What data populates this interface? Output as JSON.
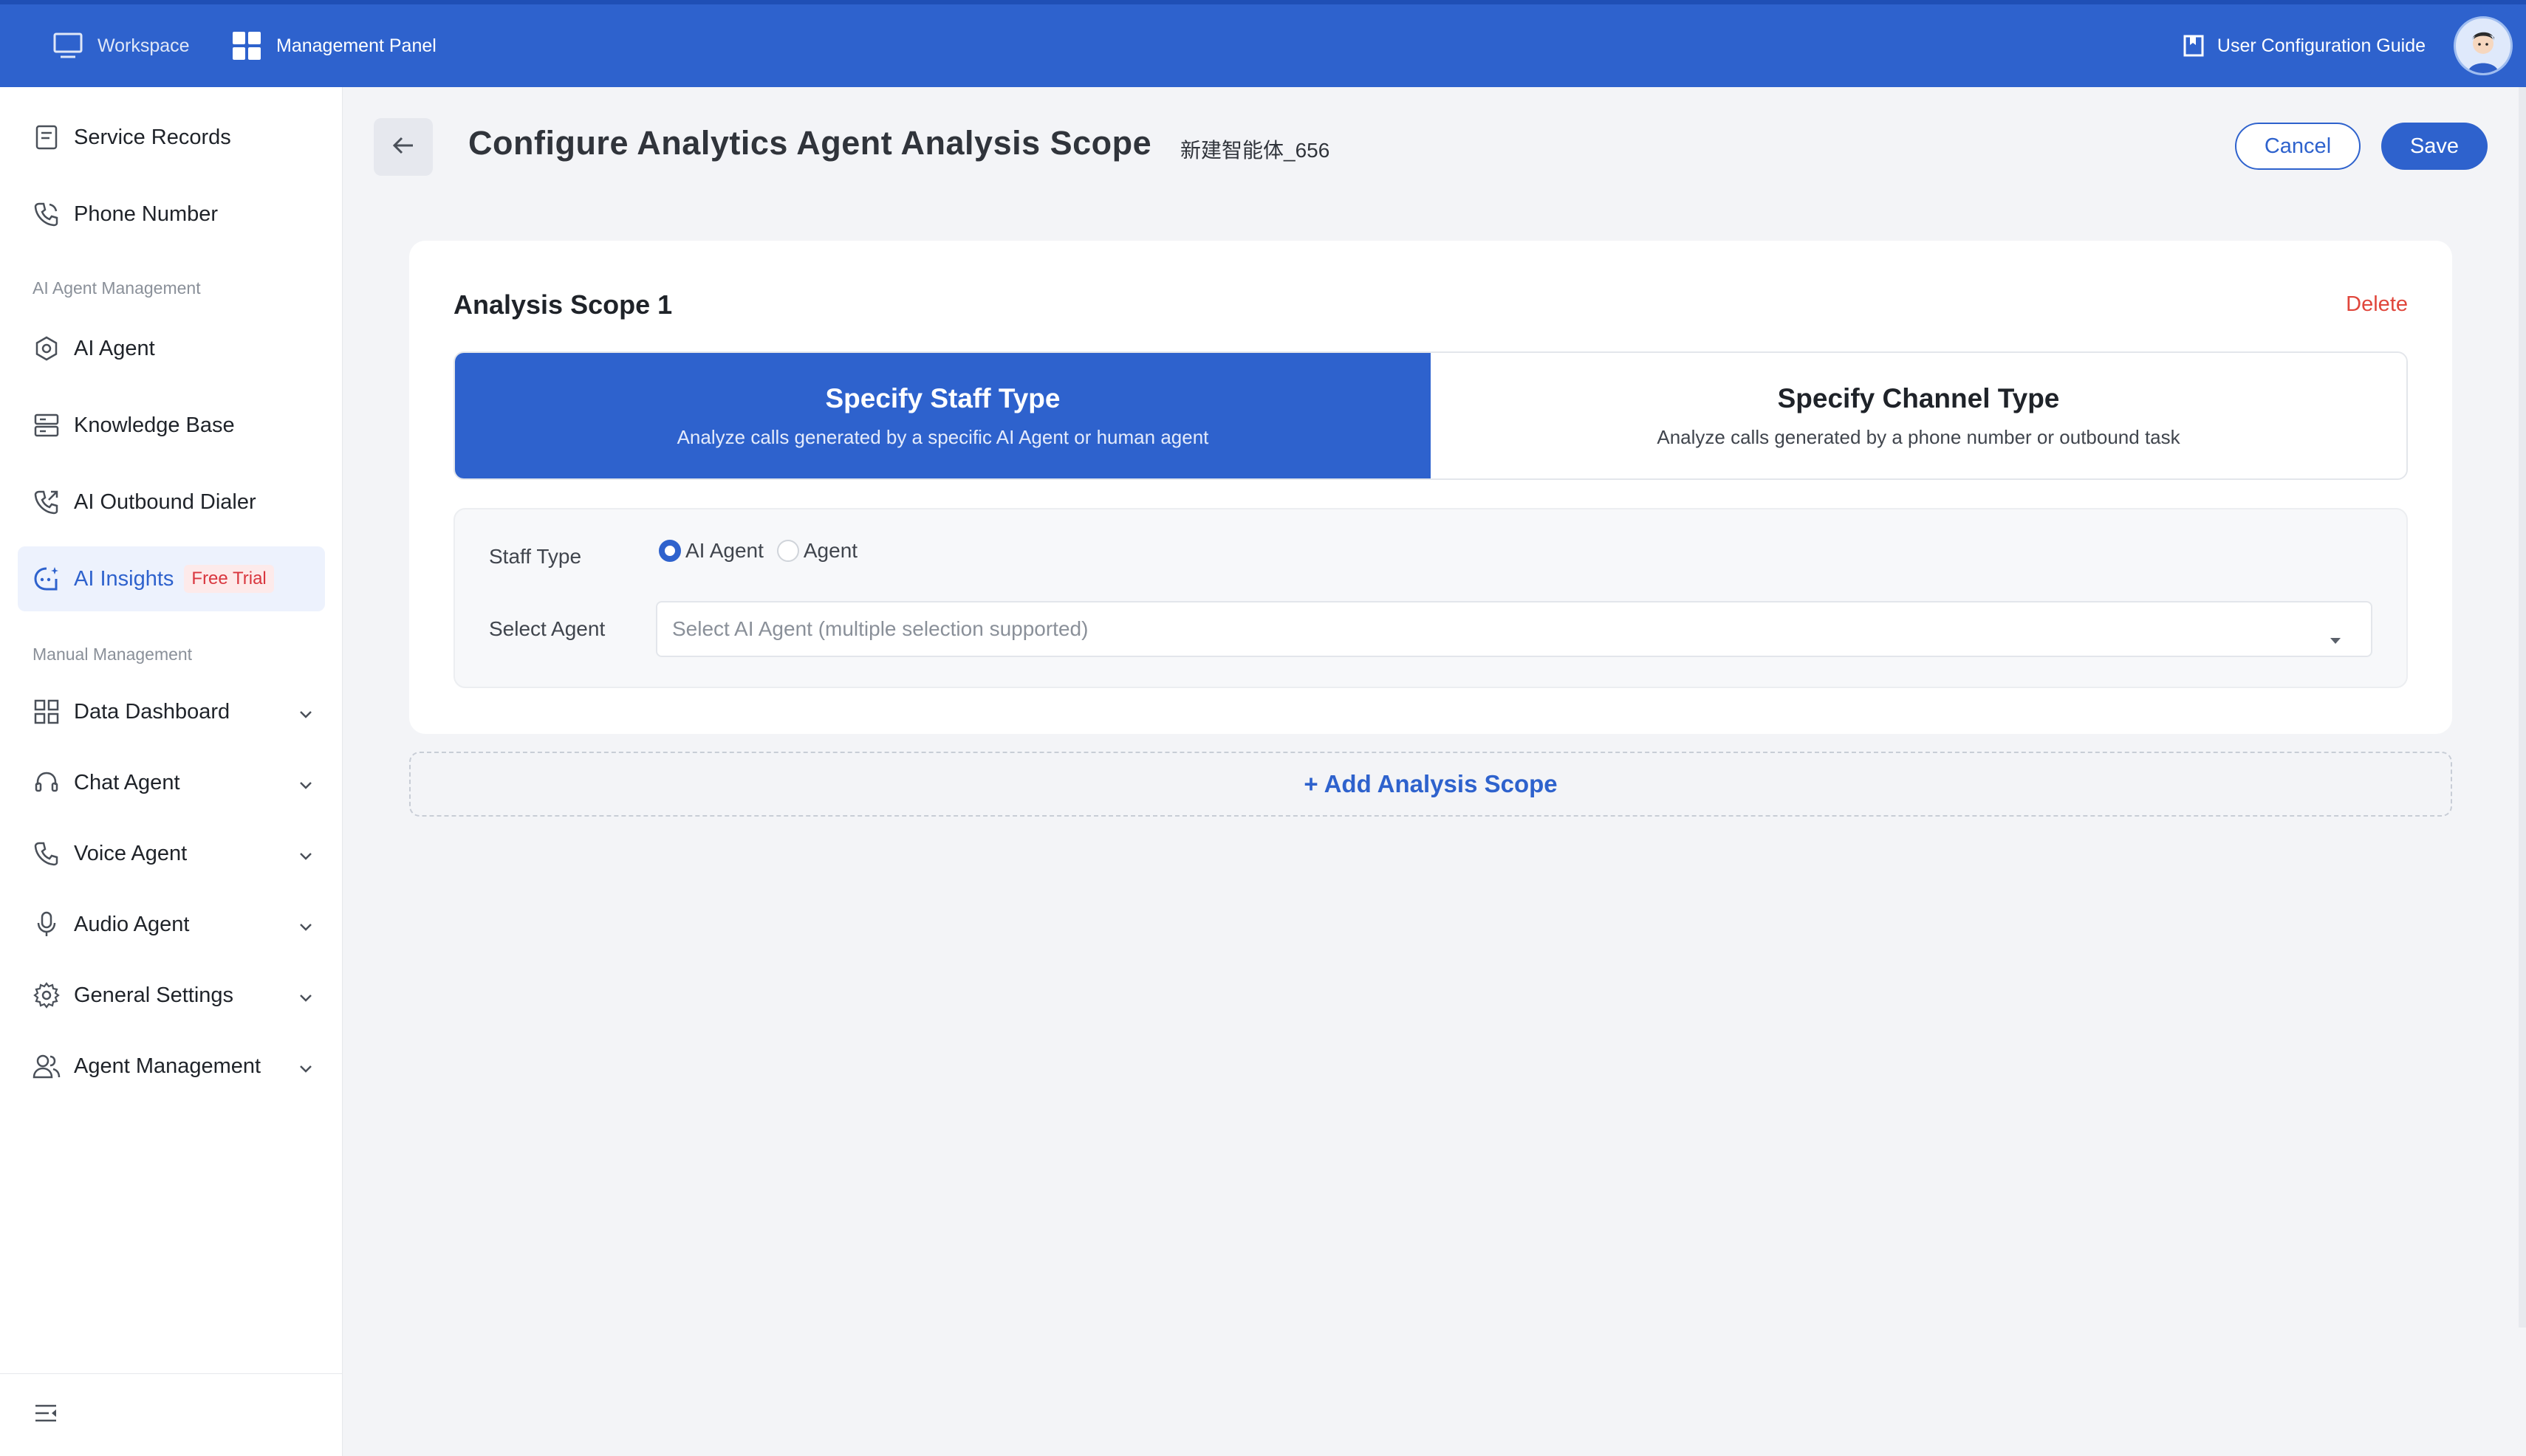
{
  "topbar": {
    "workspace_label": "Workspace",
    "management_label": "Management Panel",
    "guide_label": "User Configuration Guide",
    "accent_color": "#2e62cd"
  },
  "sidebar": {
    "items_top": [
      {
        "label": "Service Records",
        "icon": "document-icon"
      },
      {
        "label": "Phone Number",
        "icon": "phone-icon"
      }
    ],
    "section_ai": "AI Agent Management",
    "items_ai": [
      {
        "label": "AI Agent",
        "icon": "hexagon-gear-icon"
      },
      {
        "label": "Knowledge Base",
        "icon": "database-icon"
      },
      {
        "label": "AI Outbound Dialer",
        "icon": "phone-outgoing-icon"
      },
      {
        "label": "AI Insights",
        "icon": "insights-icon",
        "badge": "Free Trial",
        "active": true
      }
    ],
    "section_manual": "Manual Management",
    "items_manual": [
      {
        "label": "Data Dashboard",
        "icon": "grid-icon"
      },
      {
        "label": "Chat Agent",
        "icon": "headset-icon"
      },
      {
        "label": "Voice Agent",
        "icon": "phone-icon"
      },
      {
        "label": "Audio Agent",
        "icon": "microphone-icon"
      },
      {
        "label": "General Settings",
        "icon": "gear-icon"
      },
      {
        "label": "Agent Management",
        "icon": "users-icon"
      }
    ]
  },
  "header": {
    "title": "Configure Analytics Agent Analysis Scope",
    "agent_name": "新建智能体_656",
    "cancel_label": "Cancel",
    "save_label": "Save"
  },
  "scope": {
    "title": "Analysis Scope 1",
    "delete_label": "Delete",
    "tabs": [
      {
        "title": "Specify Staff Type",
        "desc": "Analyze calls generated by a specific AI Agent or human agent",
        "active": true
      },
      {
        "title": "Specify Channel Type",
        "desc": "Analyze calls generated by a phone number or outbound task",
        "active": false
      }
    ],
    "staff_type_label": "Staff Type",
    "radio_options": [
      {
        "label": "AI Agent",
        "checked": true
      },
      {
        "label": "Agent",
        "checked": false
      }
    ],
    "select_agent_label": "Select Agent",
    "select_placeholder": "Select AI Agent (multiple selection supported)"
  },
  "add_scope_label": "+ Add Analysis Scope"
}
